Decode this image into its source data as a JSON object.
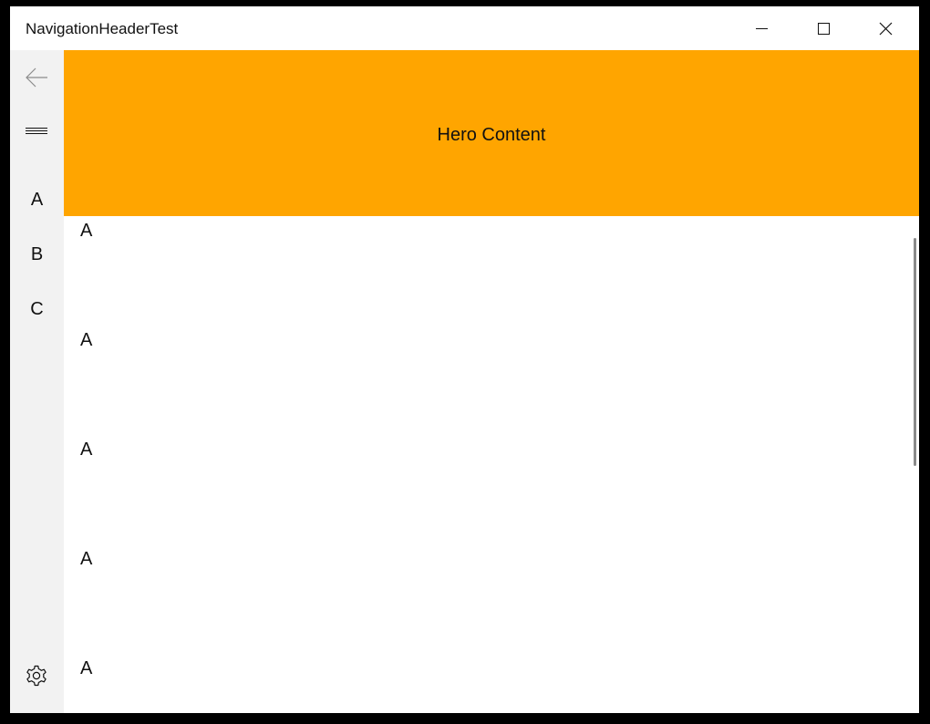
{
  "window": {
    "title": "NavigationHeaderTest"
  },
  "caption": {
    "minimize_icon": "minimize-icon",
    "maximize_icon": "maximize-icon",
    "close_icon": "close-icon"
  },
  "nav": {
    "back_icon": "back-arrow-icon",
    "menu_icon": "hamburger-menu-icon",
    "items": [
      {
        "label": "A"
      },
      {
        "label": "B"
      },
      {
        "label": "C"
      }
    ],
    "settings_icon": "gear-icon"
  },
  "hero": {
    "text": "Hero Content",
    "color": "#ffa500"
  },
  "list": {
    "items": [
      {
        "label": "A"
      },
      {
        "label": "A"
      },
      {
        "label": "A"
      },
      {
        "label": "A"
      },
      {
        "label": "A"
      }
    ]
  }
}
